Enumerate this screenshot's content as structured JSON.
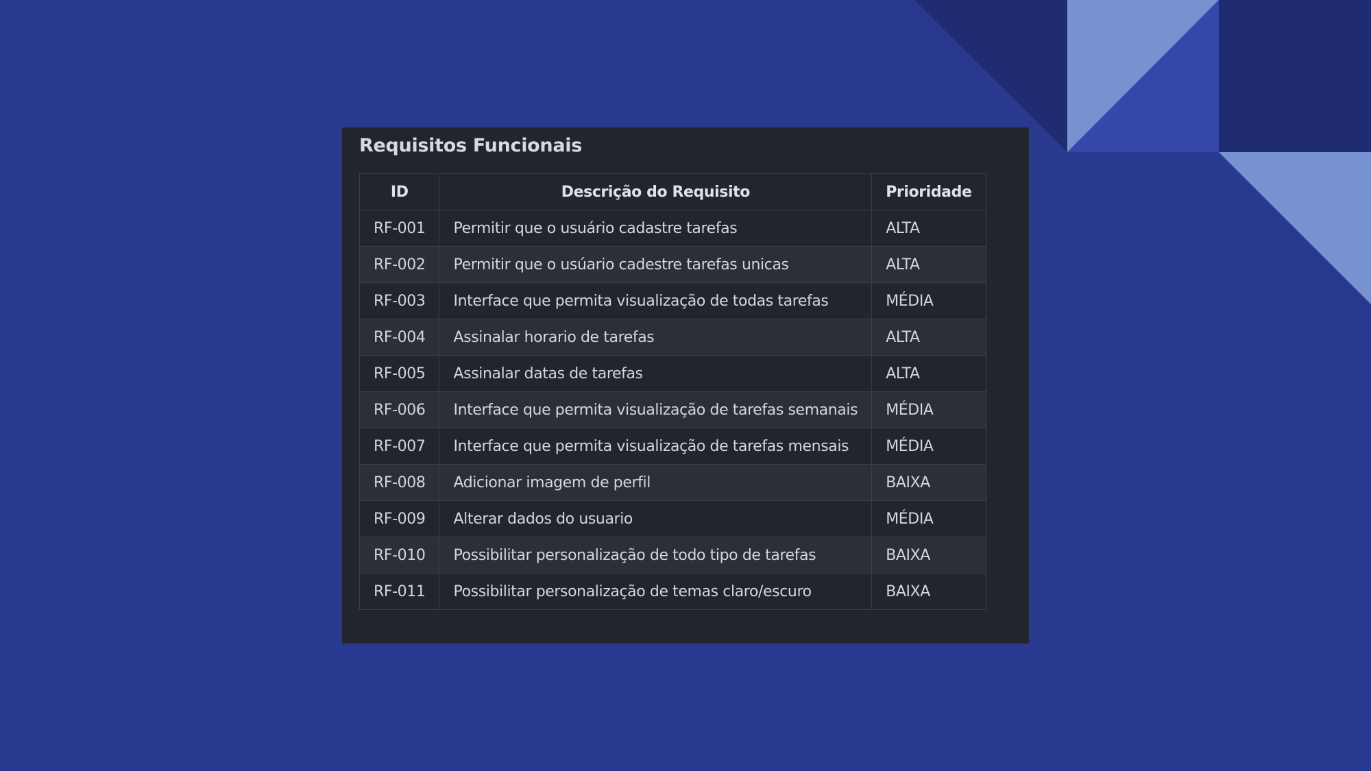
{
  "colors": {
    "background": "#28398f",
    "panel": "#22262c",
    "row_alt": "#2c3036",
    "text": "#d3d6db",
    "grid": "#3a3f46",
    "deco_dark": "#202c72",
    "deco_light": "#7891d0",
    "deco_mid": "#3547a9"
  },
  "title": "Requisitos Funcionais",
  "table": {
    "headers": {
      "id": "ID",
      "description": "Descrição do Requisito",
      "priority": "Prioridade"
    },
    "rows": [
      {
        "id": "RF-001",
        "description": "Permitir que o usuário cadastre tarefas",
        "priority": "ALTA"
      },
      {
        "id": "RF-002",
        "description": "Permitir que o usúario cadestre tarefas unicas",
        "priority": "ALTA"
      },
      {
        "id": "RF-003",
        "description": "Interface que permita visualização de todas tarefas",
        "priority": "MÉDIA"
      },
      {
        "id": "RF-004",
        "description": "Assinalar horario de tarefas",
        "priority": "ALTA"
      },
      {
        "id": "RF-005",
        "description": "Assinalar datas de tarefas",
        "priority": "ALTA"
      },
      {
        "id": "RF-006",
        "description": "Interface que permita visualização de tarefas semanais",
        "priority": "MÉDIA"
      },
      {
        "id": "RF-007",
        "description": "Interface que permita visualização de tarefas mensais",
        "priority": "MÉDIA"
      },
      {
        "id": "RF-008",
        "description": "Adicionar imagem de perfil",
        "priority": "BAIXA"
      },
      {
        "id": "RF-009",
        "description": "Alterar dados do usuario",
        "priority": "MÉDIA"
      },
      {
        "id": "RF-010",
        "description": "Possibilitar personalização de todo tipo de tarefas",
        "priority": "BAIXA"
      },
      {
        "id": "RF-011",
        "description": "Possibilitar personalização de temas claro/escuro",
        "priority": "BAIXA"
      }
    ]
  }
}
